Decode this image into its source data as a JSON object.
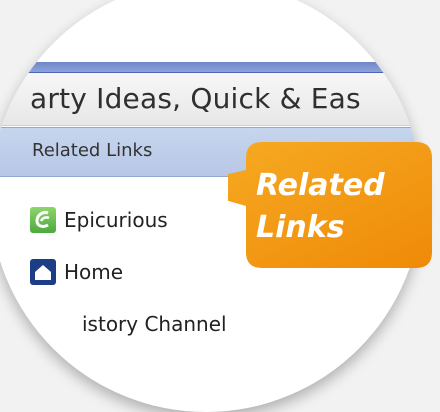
{
  "page": {
    "title_fragment": "arty Ideas, Quick & Eas",
    "tab": {
      "label": "Related Links"
    },
    "links": [
      {
        "label": "Epicurious",
        "icon": "epicurious-icon"
      },
      {
        "label": "Home",
        "icon": "home-icon"
      },
      {
        "label": "istory Channel",
        "icon": ""
      }
    ],
    "callout": {
      "text": "Related\nLinks"
    },
    "colors": {
      "callout": "#f39b16",
      "tabbar": "#c6d6ee",
      "topbar": "#6f86c9"
    }
  }
}
